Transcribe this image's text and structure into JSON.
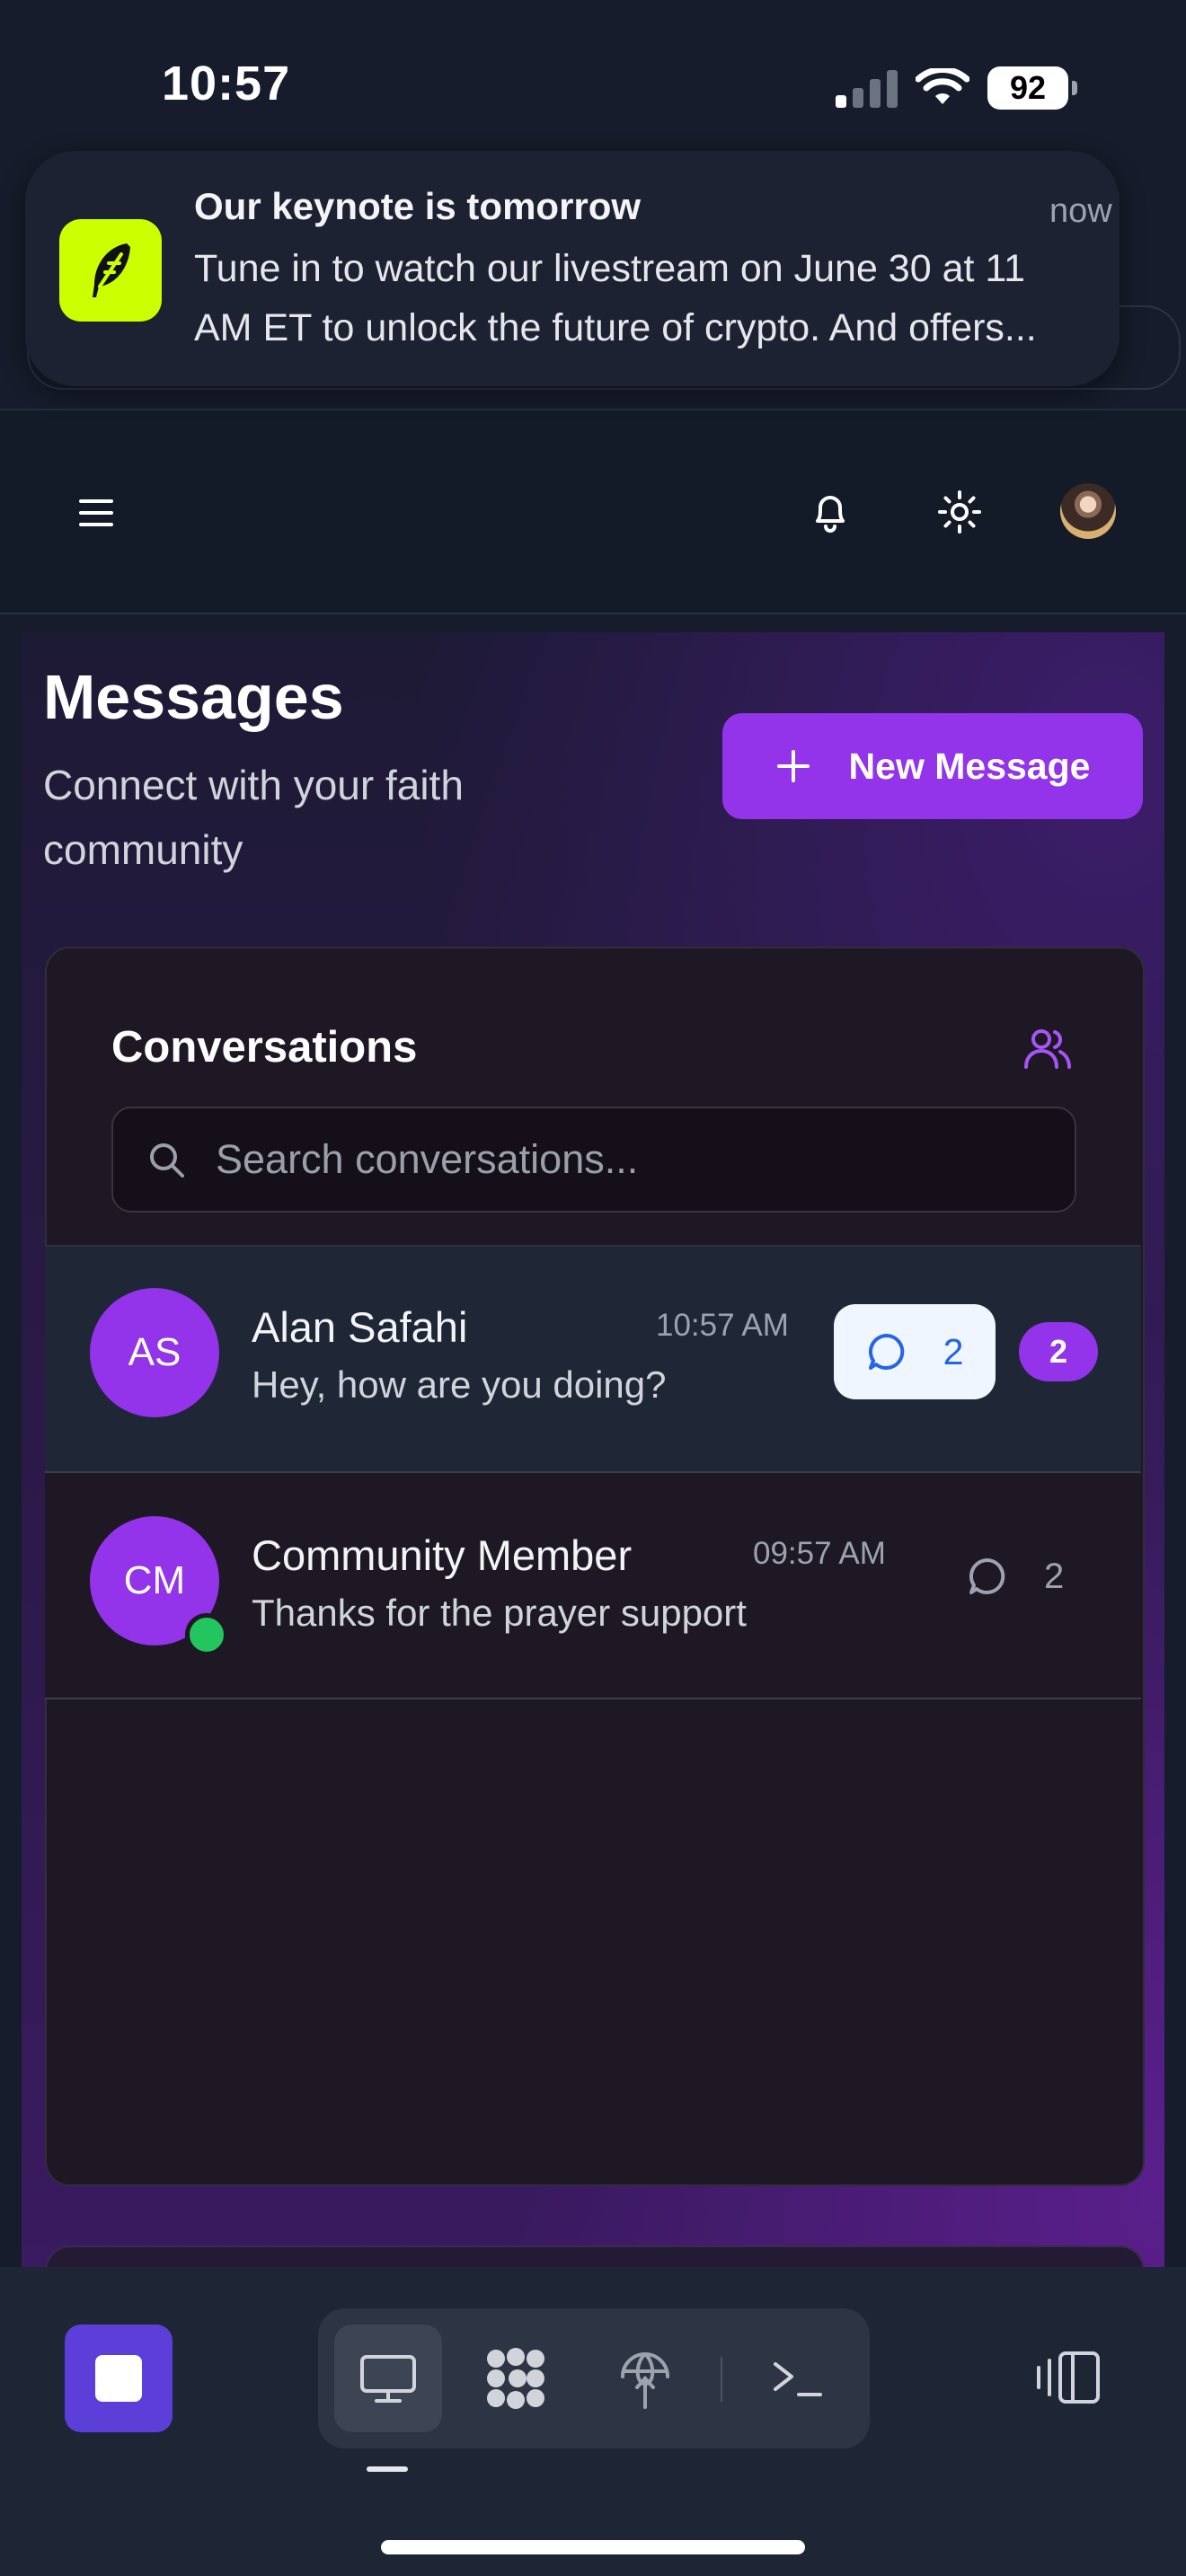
{
  "status_bar": {
    "time": "10:57",
    "battery": "92"
  },
  "notification": {
    "title": "Our keynote is tomorrow",
    "time": "now",
    "body_line1": "Tune in to watch our livestream on June 30 at 11",
    "body_line2": "AM ET to unlock the future of crypto. And offers...",
    "app_icon": "feather-icon",
    "app_color": "#ccff00"
  },
  "header": {
    "menu_icon": "hamburger-menu-icon",
    "bell_icon": "bell-icon",
    "theme_icon": "sun-icon"
  },
  "page": {
    "title": "Messages",
    "subtitle": "Connect with your faith community",
    "new_message_label": "New Message",
    "accent": "#9333ea"
  },
  "conversations": {
    "title": "Conversations",
    "search_placeholder": "Search conversations...",
    "items": [
      {
        "initials": "AS",
        "name": "Alan Safahi",
        "time": "10:57 AM",
        "preview": "Hey, how are you doing?",
        "reply_count": "2",
        "unread": "2",
        "online": false,
        "selected": true
      },
      {
        "initials": "CM",
        "name": "Community Member",
        "time": "09:57 AM",
        "preview": "Thanks for the prayer support",
        "reply_count": "2",
        "online": true,
        "selected": false
      }
    ]
  },
  "toolbar": {
    "stop_color": "#5b3fd8",
    "items": [
      "monitor-icon",
      "apps-grid-icon",
      "globe-upload-icon",
      "terminal-icon"
    ],
    "panel_icon": "panel-toggle-icon"
  }
}
